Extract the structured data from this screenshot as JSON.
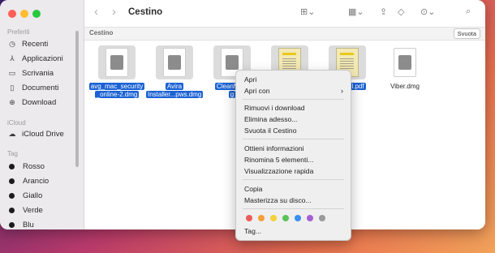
{
  "sidebar": {
    "favorites_label": "Preferiti",
    "favorites": [
      {
        "label": "Recenti",
        "icon": "clock-icon"
      },
      {
        "label": "Applicazioni",
        "icon": "applications-icon"
      },
      {
        "label": "Scrivania",
        "icon": "desktop-icon"
      },
      {
        "label": "Documenti",
        "icon": "document-icon"
      },
      {
        "label": "Download",
        "icon": "download-icon"
      }
    ],
    "icloud_label": "iCloud",
    "icloud_drive": "iCloud Drive",
    "tags_label": "Tag",
    "tags": [
      "Rosso",
      "Arancio",
      "Giallo",
      "Verde",
      "Blu"
    ]
  },
  "toolbar": {
    "title": "Cestino"
  },
  "pathbar": {
    "crumb": "Cestino",
    "empty_button": "Svuota"
  },
  "files": [
    {
      "name": "avg_mac_security_online-2.dmg",
      "line1": "avg_mac_security",
      "line2": "_online-2.dmg",
      "type": "dmg",
      "selected": true
    },
    {
      "name": "Avira Installer...pws.dmg",
      "line1": "Avira",
      "line2": "Installer...pws.dmg",
      "type": "dmg",
      "selected": true
    },
    {
      "name": "CleanMyMac...g",
      "line1": "CleanMyM",
      "line2": "g",
      "type": "dmg",
      "selected": true
    },
    {
      "name": "pdf",
      "line1": "",
      "line2": "",
      "type": "pdf",
      "selected": true
    },
    {
      "name": "....pdf",
      "line1": "l.pdf",
      "line2": "",
      "type": "pdf",
      "selected": true
    },
    {
      "name": "Viber.dmg",
      "line1": "Viber.dmg",
      "line2": "",
      "type": "dmg",
      "selected": false
    }
  ],
  "context_menu": {
    "open": "Apri",
    "open_with": "Apri con",
    "remove_download": "Rimuovi i download",
    "delete_now": "Elimina adesso...",
    "empty_trash": "Svuota il Cestino",
    "get_info": "Ottieni informazioni",
    "rename": "Rinomina 5 elementi...",
    "quick_look": "Visualizzazione rapida",
    "copy": "Copia",
    "burn": "Masterizza su disco...",
    "tags": "Tag...",
    "tag_colors": [
      "#ee5a5a",
      "#f3a03a",
      "#f4d03a",
      "#5ac35a",
      "#3a8ef0",
      "#a55fd3",
      "#9a9a9a"
    ]
  }
}
